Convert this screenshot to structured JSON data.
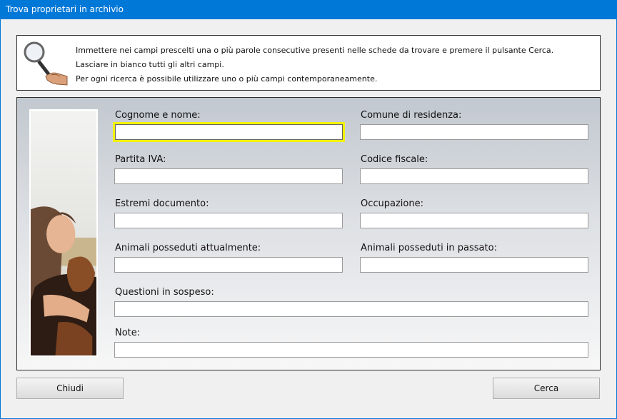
{
  "window": {
    "title": "Trova proprietari in archivio"
  },
  "info": {
    "lines": [
      "Immettere nei campi prescelti una o più parole consecutive presenti nelle schede da trovare e premere il pulsante Cerca.",
      "Lasciare in bianco tutti gli altri campi.",
      "Per ogni ricerca è possibile utilizzare uno o più campi contemporaneamente."
    ]
  },
  "fields": {
    "cognome_nome": {
      "label": "Cognome e nome:",
      "value": ""
    },
    "comune": {
      "label": "Comune di residenza:",
      "value": ""
    },
    "partita_iva": {
      "label": "Partita IVA:",
      "value": ""
    },
    "codice_fiscale": {
      "label": "Codice fiscale:",
      "value": ""
    },
    "estremi_documento": {
      "label": "Estremi documento:",
      "value": ""
    },
    "occupazione": {
      "label": "Occupazione:",
      "value": ""
    },
    "animali_attuali": {
      "label": "Animali posseduti attualmente:",
      "value": ""
    },
    "animali_passato": {
      "label": "Animali posseduti in passato:",
      "value": ""
    },
    "questioni": {
      "label": "Questioni in sospeso:",
      "value": ""
    },
    "note": {
      "label": "Note:",
      "value": ""
    }
  },
  "buttons": {
    "close": "Chiudi",
    "search": "Cerca"
  },
  "colors": {
    "titlebar": "#0078d7",
    "focus_highlight": "#f2f200"
  },
  "icons": {
    "search": "magnifier-hand-icon"
  }
}
